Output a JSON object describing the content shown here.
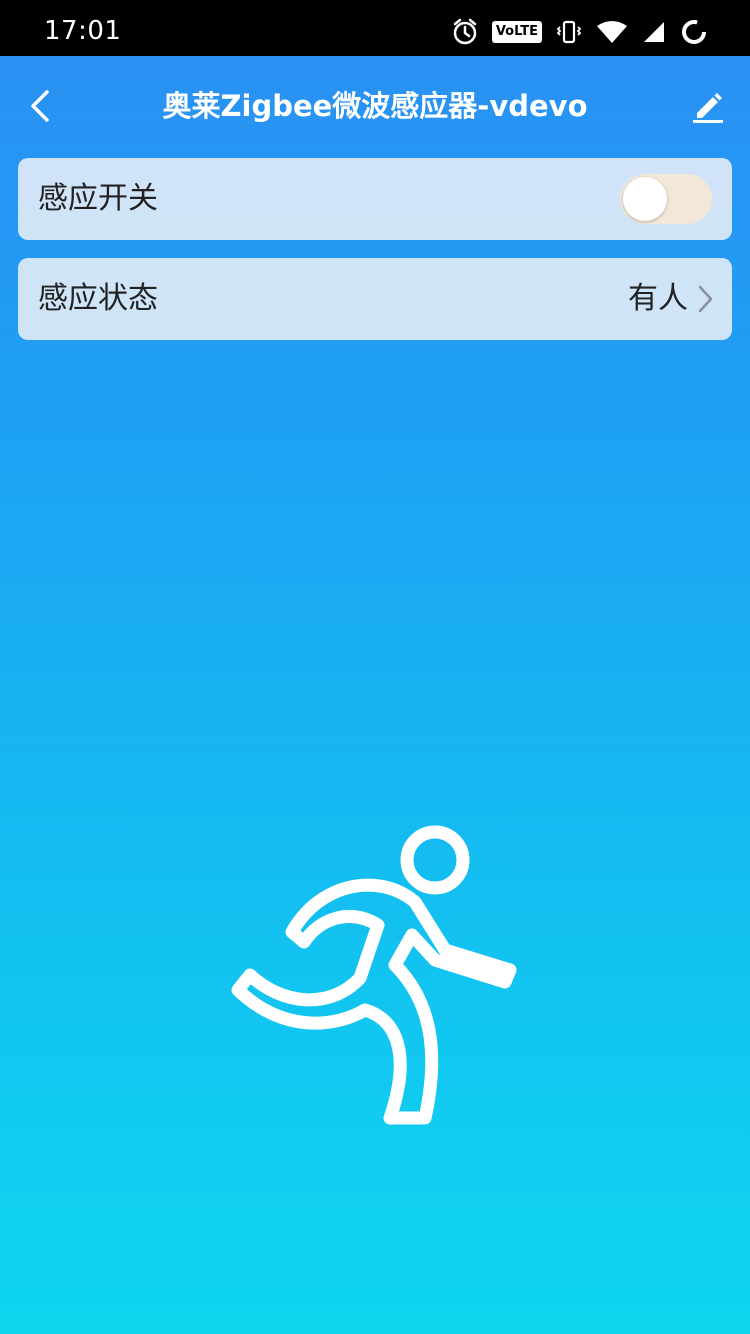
{
  "status_bar": {
    "time": "17:01",
    "volte": "VoLTE",
    "icons": [
      "alarm-icon",
      "volte-icon",
      "vibrate-icon",
      "wifi-icon",
      "signal-icon",
      "loading-icon"
    ]
  },
  "header": {
    "title": "奥莱Zigbee微波感应器-vdevo",
    "back_icon": "chevron-left-icon",
    "edit_icon": "pencil-icon"
  },
  "settings": {
    "sensing_switch": {
      "label": "感应开关",
      "enabled": false
    },
    "sensing_status": {
      "label": "感应状态",
      "value": "有人"
    }
  },
  "illustration": {
    "icon": "running-person-icon"
  },
  "colors": {
    "gradient_top": "#2b8ff3",
    "gradient_bottom": "#0fd6ef",
    "card_bg": "#e8eef8",
    "toggle_track": "#f3e8d8",
    "text_dark": "#222222",
    "status_bar": "#000000"
  }
}
